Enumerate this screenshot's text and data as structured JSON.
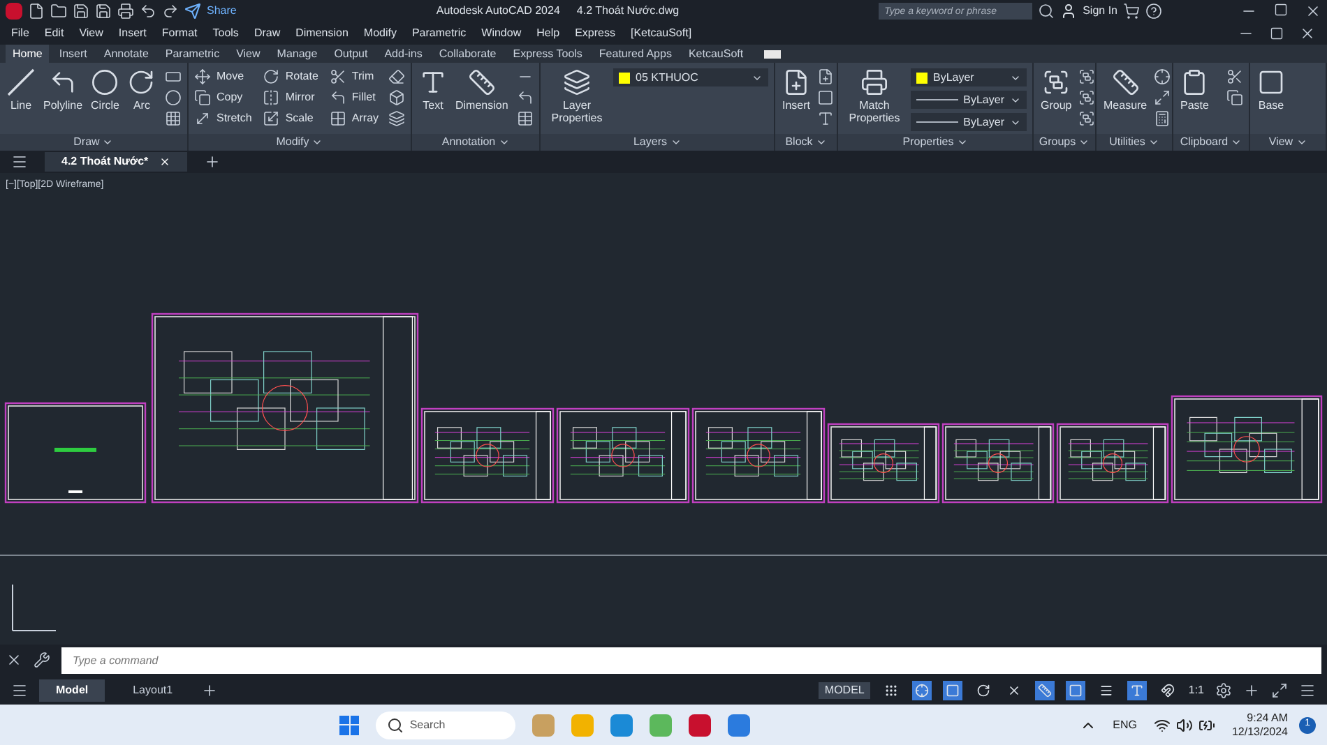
{
  "title_bar": {
    "share": "Share",
    "title": "Autodesk AutoCAD 2024",
    "filename": "4.2 Thoát Nước.dwg",
    "search_placeholder": "Type a keyword or phrase",
    "sign_in": "Sign In"
  },
  "menu": [
    "File",
    "Edit",
    "View",
    "Insert",
    "Format",
    "Tools",
    "Draw",
    "Dimension",
    "Modify",
    "Parametric",
    "Window",
    "Help",
    "Express",
    "[KetcauSoft]"
  ],
  "ribbon_tabs": [
    {
      "label": "Home",
      "selected": true
    },
    {
      "label": "Insert",
      "selected": false
    },
    {
      "label": "Annotate",
      "selected": false
    },
    {
      "label": "Parametric",
      "selected": false
    },
    {
      "label": "View",
      "selected": false
    },
    {
      "label": "Manage",
      "selected": false
    },
    {
      "label": "Output",
      "selected": false
    },
    {
      "label": "Add-ins",
      "selected": false
    },
    {
      "label": "Collaborate",
      "selected": false
    },
    {
      "label": "Express Tools",
      "selected": false
    },
    {
      "label": "Featured Apps",
      "selected": false
    },
    {
      "label": "KetcauSoft",
      "selected": false
    }
  ],
  "panels": [
    {
      "title": "Draw",
      "large": [
        "Line",
        "Polyline",
        "Circle",
        "Arc"
      ]
    },
    {
      "title": "Modify",
      "small": [
        "Move",
        "Copy",
        "Stretch",
        "Rotate",
        "Mirror",
        "Scale",
        "Trim",
        "Fillet",
        "Array"
      ]
    },
    {
      "title": "Annotation",
      "large": [
        "Text",
        "Dimension"
      ]
    },
    {
      "title": "Layers",
      "large": [
        "Layer Properties"
      ],
      "dropdowns": [
        {
          "value": "05 KTHUOC",
          "color": "#ffff00"
        }
      ]
    },
    {
      "title": "Block",
      "large": [
        "Insert"
      ]
    },
    {
      "title": "Properties",
      "large": [
        "Match Properties"
      ],
      "dropdowns": [
        {
          "value": "ByLayer",
          "color": "#ffff00"
        },
        {
          "value": "ByLayer"
        },
        {
          "value": "ByLayer"
        }
      ]
    },
    {
      "title": "Groups",
      "large": [
        "Group"
      ]
    },
    {
      "title": "Utilities",
      "large": [
        "Measure"
      ]
    },
    {
      "title": "Clipboard",
      "large": [
        "Paste"
      ]
    },
    {
      "title": "View",
      "large": [
        "Base"
      ]
    }
  ],
  "document_tab": {
    "label": "4.2 Thoát Nước*"
  },
  "viewport": {
    "label": "[−][Top][2D Wireframe]"
  },
  "command_line": {
    "placeholder": "Type a command"
  },
  "layout_tabs": [
    {
      "label": "Model",
      "selected": true
    },
    {
      "label": "Layout1",
      "selected": false
    }
  ],
  "status_bar": {
    "mode": "MODEL",
    "scale": "1:1",
    "toggles": [
      {
        "on": false
      },
      {
        "on": true
      },
      {
        "on": true
      },
      {
        "on": false
      },
      {
        "on": false
      },
      {
        "on": true
      },
      {
        "on": true
      },
      {
        "on": false
      },
      {
        "on": true
      },
      {
        "on": false
      }
    ]
  },
  "taskbar": {
    "search": "Search",
    "language": "ENG",
    "time": "9:24 AM",
    "date": "12/13/2024",
    "notifications": "1"
  }
}
